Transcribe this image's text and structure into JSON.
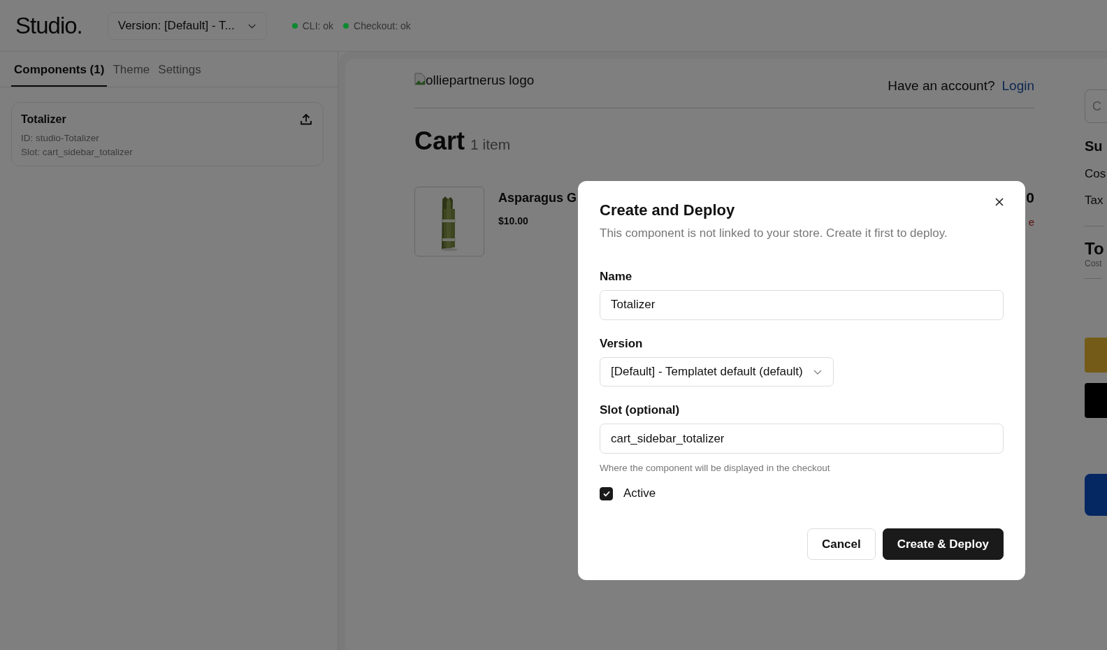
{
  "header": {
    "logo": "Studio.",
    "version_select": "Version: [Default] - T...",
    "statuses": [
      {
        "label": "CLI: ok",
        "color": "#0b8a2e"
      },
      {
        "label": "Checkout: ok",
        "color": "#0b8a2e"
      }
    ]
  },
  "tabs": [
    {
      "label": "Components (1)",
      "selected": true
    },
    {
      "label": "Theme",
      "selected": false
    },
    {
      "label": "Settings",
      "selected": false
    }
  ],
  "components": [
    {
      "name": "Totalizer",
      "id": "ID: studio-Totalizer",
      "slot": "Slot: cart_sidebar_totalizer"
    }
  ],
  "preview": {
    "logo_alt": "olliepartnerus logo",
    "account_prompt": "Have an account?",
    "login": "Login",
    "cart_title": "Cart",
    "item_count": "1 item",
    "items": [
      {
        "kind": "picture",
        "name": "Asparagus G",
        "price": "$10.00",
        "total": "0",
        "remove": "e"
      }
    ],
    "sidebar": {
      "code_placeholder": "C",
      "summary": "Su",
      "lines": [
        "Cos",
        "Tax"
      ],
      "total": "To",
      "total_note": "Cost"
    }
  },
  "dialog": {
    "title": "Create and Deploy",
    "description": "This component is not linked to your store. Create it first to deploy.",
    "name_label": "Name",
    "name_value": "Totalizer",
    "version_label": "Version",
    "version_value": "[Default] - Templatet default (default)",
    "slot_label": "Slot (optional)",
    "slot_value": "cart_sidebar_totalizer",
    "slot_help": "Where the component will be displayed in the checkout",
    "active_label": "Active",
    "active": true,
    "buttons": [
      "Cancel",
      "Create & Deploy"
    ]
  }
}
